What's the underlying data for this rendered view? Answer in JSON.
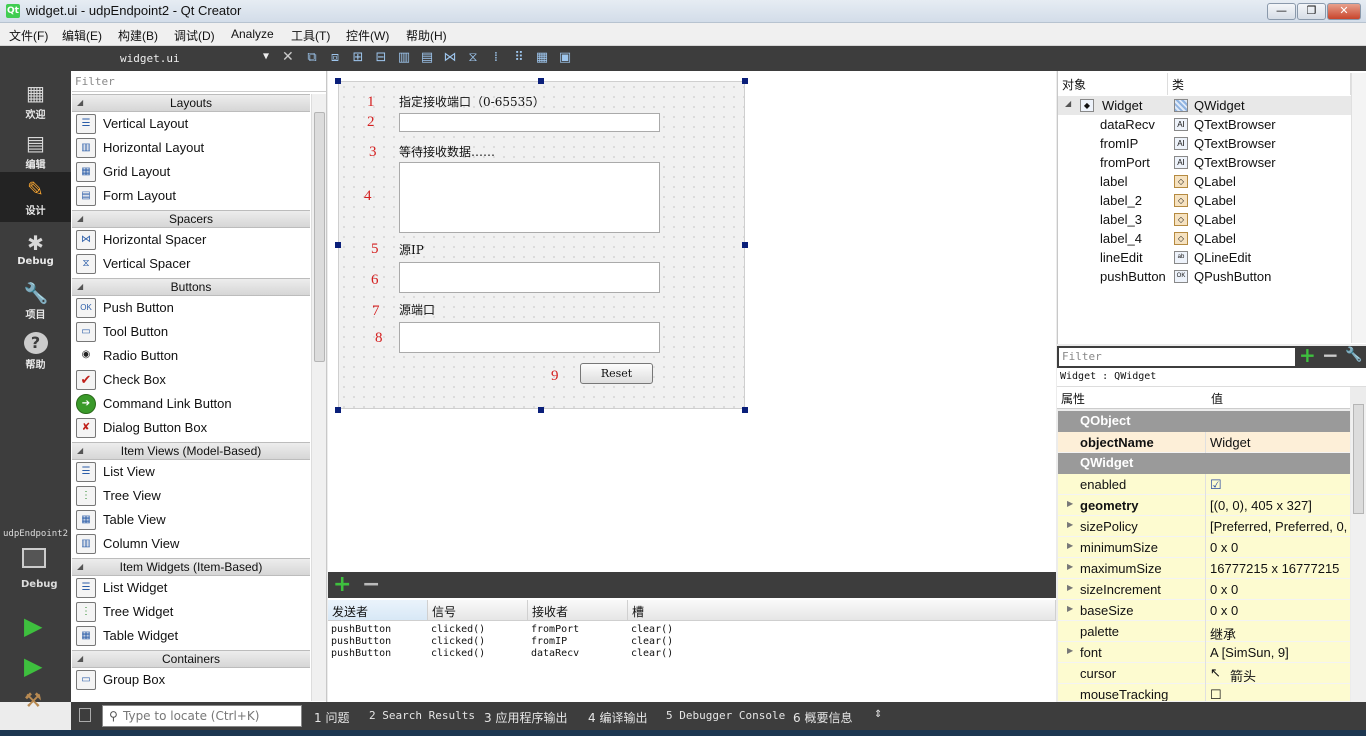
{
  "window": {
    "title": "widget.ui - udpEndpoint2 - Qt Creator",
    "app_icon": "Qt",
    "buttons": [
      "minimize",
      "maximize",
      "close"
    ]
  },
  "menu": [
    "文件(F)",
    "编辑(E)",
    "构建(B)",
    "调试(D)",
    "Analyze",
    "工具(T)",
    "控件(W)",
    "帮助(H)"
  ],
  "modes": [
    {
      "label": "欢迎",
      "icon": "grid-icon"
    },
    {
      "label": "编辑",
      "icon": "document-icon"
    },
    {
      "label": "设计",
      "icon": "pencil-icon"
    },
    {
      "label": "Debug",
      "icon": "bug-icon"
    },
    {
      "label": "项目",
      "icon": "wrench-icon"
    },
    {
      "label": "帮助",
      "icon": "help-icon"
    }
  ],
  "target": {
    "project": "udpEndpoint2",
    "mode": "Debug"
  },
  "editor": {
    "file": "widget.ui"
  },
  "widget_box": {
    "filter_placeholder": "Filter",
    "categories": [
      {
        "name": "Layouts",
        "items": [
          "Vertical Layout",
          "Horizontal Layout",
          "Grid Layout",
          "Form Layout"
        ]
      },
      {
        "name": "Spacers",
        "items": [
          "Horizontal Spacer",
          "Vertical Spacer"
        ]
      },
      {
        "name": "Buttons",
        "items": [
          "Push Button",
          "Tool Button",
          "Radio Button",
          "Check Box",
          "Command Link Button",
          "Dialog Button Box"
        ]
      },
      {
        "name": "Item Views (Model-Based)",
        "items": [
          "List View",
          "Tree View",
          "Table View",
          "Column View"
        ]
      },
      {
        "name": "Item Widgets (Item-Based)",
        "items": [
          "List Widget",
          "Tree Widget",
          "Table Widget"
        ]
      },
      {
        "name": "Containers",
        "items": [
          "Group Box"
        ]
      }
    ]
  },
  "form": {
    "label1": "指定接收端口（0-65535）",
    "label2": "等待接收数据……",
    "label3": "源IP",
    "label4": "源端口",
    "reset": "Reset",
    "numbers": [
      "1",
      "2",
      "3",
      "4",
      "5",
      "6",
      "7",
      "8",
      "9"
    ]
  },
  "signals": {
    "headers": [
      "发送者",
      "信号",
      "接收者",
      "槽"
    ],
    "rows": [
      [
        "pushButton",
        "clicked()",
        "fromPort",
        "clear()"
      ],
      [
        "pushButton",
        "clicked()",
        "fromIP",
        "clear()"
      ],
      [
        "pushButton",
        "clicked()",
        "dataRecv",
        "clear()"
      ]
    ]
  },
  "object_inspector": {
    "headers": [
      "对象",
      "类"
    ],
    "root": {
      "name": "Widget",
      "class": "QWidget"
    },
    "children": [
      {
        "name": "dataRecv",
        "class": "QTextBrowser"
      },
      {
        "name": "fromIP",
        "class": "QTextBrowser"
      },
      {
        "name": "fromPort",
        "class": "QTextBrowser"
      },
      {
        "name": "label",
        "class": "QLabel"
      },
      {
        "name": "label_2",
        "class": "QLabel"
      },
      {
        "name": "label_3",
        "class": "QLabel"
      },
      {
        "name": "label_4",
        "class": "QLabel"
      },
      {
        "name": "lineEdit",
        "class": "QLineEdit"
      },
      {
        "name": "pushButton",
        "class": "QPushButton"
      }
    ]
  },
  "property_editor": {
    "filter_placeholder": "Filter",
    "subtitle": "Widget : QWidget",
    "headers": [
      "属性",
      "值"
    ],
    "group1": "QObject",
    "objectName": {
      "name": "objectName",
      "value": "Widget"
    },
    "group2": "QWidget",
    "props": [
      {
        "name": "enabled",
        "value": "☑"
      },
      {
        "name": "geometry",
        "value": "[(0, 0), 405 x 327]"
      },
      {
        "name": "sizePolicy",
        "value": "[Preferred, Preferred, 0, 0]"
      },
      {
        "name": "minimumSize",
        "value": "0 x 0"
      },
      {
        "name": "maximumSize",
        "value": "16777215 x 16777215"
      },
      {
        "name": "sizeIncrement",
        "value": "0 x 0"
      },
      {
        "name": "baseSize",
        "value": "0 x 0"
      },
      {
        "name": "palette",
        "value": "继承"
      },
      {
        "name": "font",
        "value": "A  [SimSun, 9]"
      },
      {
        "name": "cursor",
        "value": "箭头"
      },
      {
        "name": "mouseTracking",
        "value": "☐"
      }
    ]
  },
  "statusbar": {
    "locate_placeholder": "Type to locate (Ctrl+K)",
    "tabs": [
      "1 问题",
      "2 Search Results",
      "3 应用程序输出",
      "4 编译输出",
      "5 Debugger Console",
      "6 概要信息"
    ]
  }
}
